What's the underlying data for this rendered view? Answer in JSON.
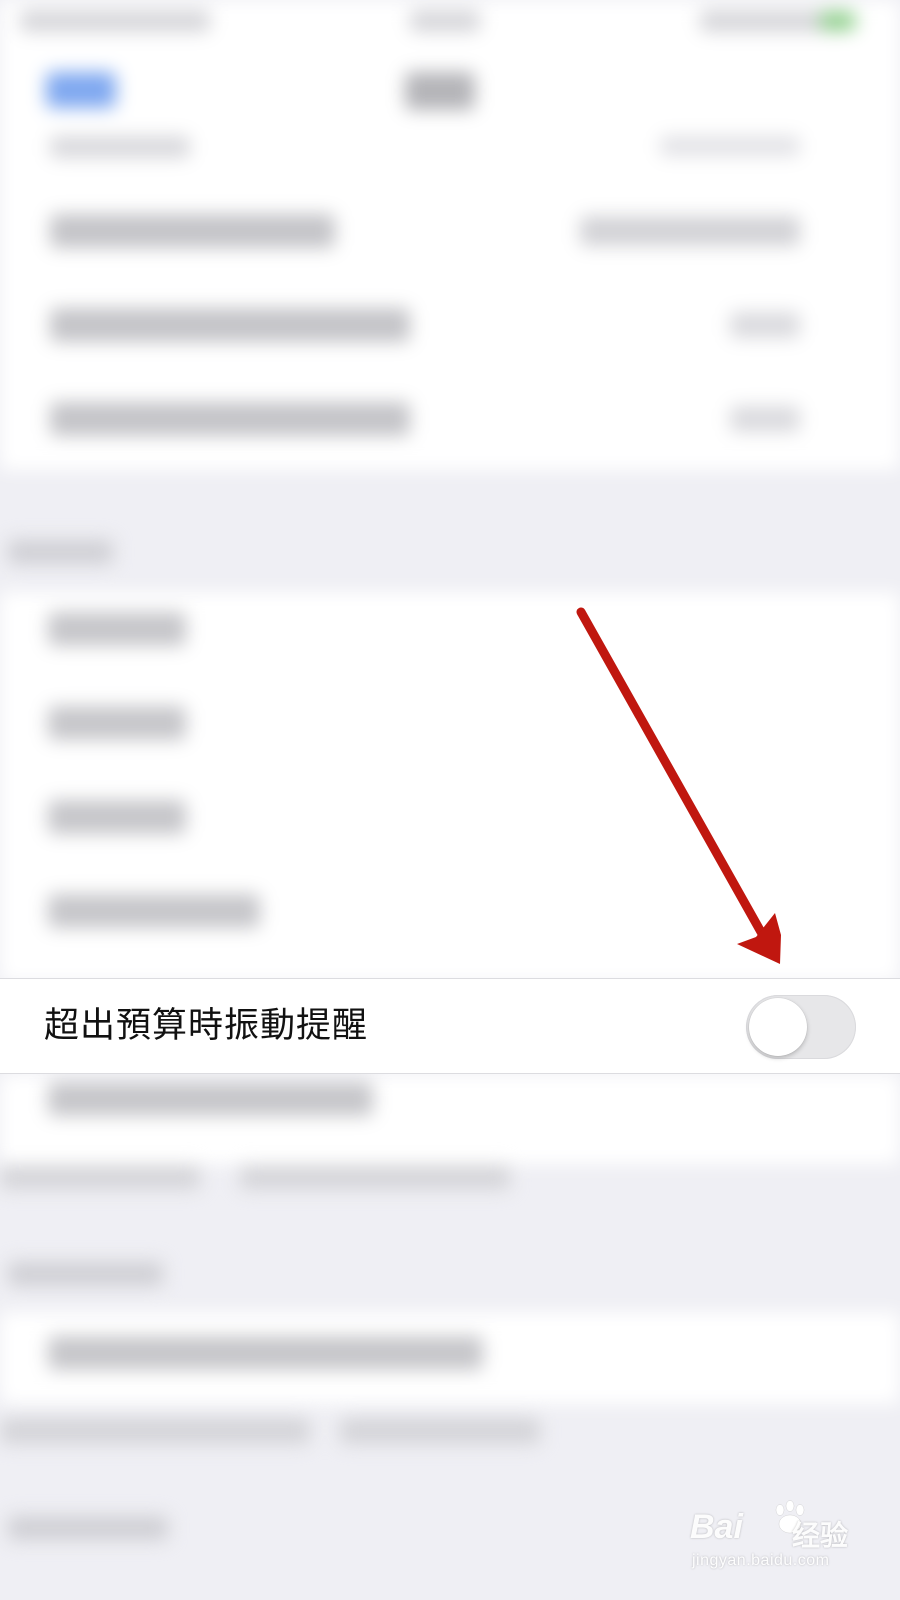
{
  "focused_setting": {
    "label": "超出預算時振動提醒",
    "toggle_state": "off"
  },
  "annotation": {
    "arrow_color": "#c0170f"
  },
  "watermark": {
    "logo_text": "Bai",
    "brand_cn": "经验",
    "url": "jingyan.baidu.com"
  },
  "colors": {
    "background": "#efeff4",
    "row": "#ffffff",
    "toggle_off": "#e7e7e9",
    "ios_blue": "#3478f6"
  }
}
